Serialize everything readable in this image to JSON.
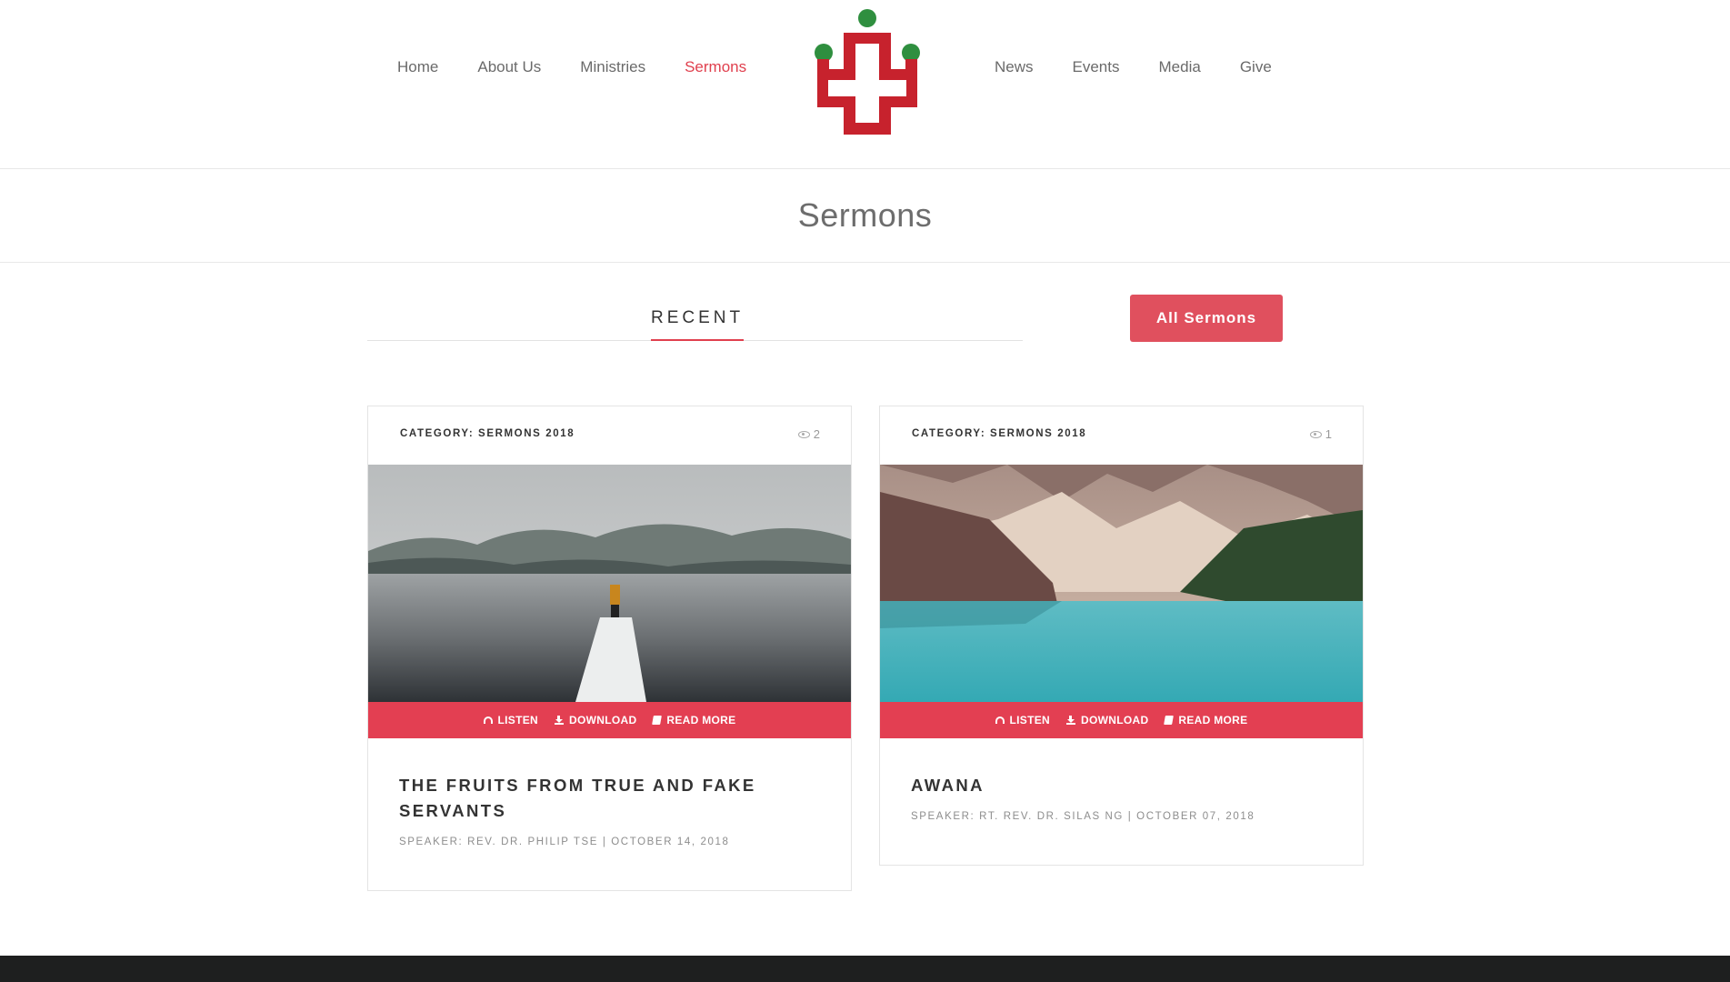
{
  "nav": {
    "left": [
      "Home",
      "About Us",
      "Ministries",
      "Sermons"
    ],
    "right": [
      "News",
      "Events",
      "Media",
      "Give"
    ],
    "active": "Sermons"
  },
  "colors": {
    "accent": "#e0404e",
    "logo_red": "#c7222d",
    "logo_green": "#2f8f3f",
    "footer": "#1e1f1f"
  },
  "page": {
    "title": "Sermons"
  },
  "tabs": {
    "recent": "RECENT",
    "all_button": "All Sermons"
  },
  "sermons": [
    {
      "category": "CATEGORY: SERMONS 2018",
      "views": "2",
      "image": "misty-lake-snowy-pier-photo",
      "actions": [
        "LISTEN",
        "DOWNLOAD",
        "READ MORE"
      ],
      "title": "THE FRUITS FROM TRUE AND FAKE SERVANTS",
      "meta": "SPEAKER: REV. DR. PHILIP TSE | OCTOBER 14, 2018"
    },
    {
      "category": "CATEGORY: SERMONS 2018",
      "views": "1",
      "image": "turquoise-mountain-lake-photo",
      "actions": [
        "LISTEN",
        "DOWNLOAD",
        "READ MORE"
      ],
      "title": "AWANA",
      "meta": "SPEAKER: RT. REV. DR. SILAS NG | OCTOBER 07, 2018"
    }
  ]
}
